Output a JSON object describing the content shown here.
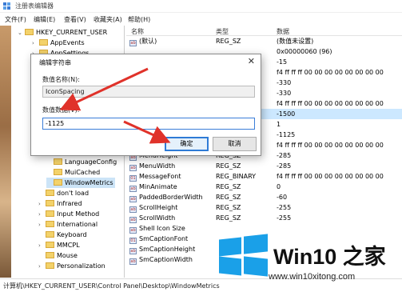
{
  "window": {
    "title": "注册表编辑器"
  },
  "menu": [
    "文件(F)",
    "编辑(E)",
    "查看(V)",
    "收藏夹(A)",
    "帮助(H)"
  ],
  "tree": {
    "items": [
      {
        "label": "HKEY_CURRENT_USER",
        "expanded": true
      },
      {
        "label": "AppEvents"
      },
      {
        "label": "AppSettings"
      },
      {
        "label": "LanguageConfig"
      },
      {
        "label": "MuiCached"
      },
      {
        "label": "WindowMetrics",
        "selected": true
      },
      {
        "label": "don't load"
      },
      {
        "label": "Infrared"
      },
      {
        "label": "Input Method"
      },
      {
        "label": "International"
      },
      {
        "label": "Keyboard"
      },
      {
        "label": "MMCPL"
      },
      {
        "label": "Mouse"
      },
      {
        "label": "Personalization"
      }
    ]
  },
  "list": {
    "headers": {
      "name": "名称",
      "type": "类型",
      "data": "数据"
    },
    "rows": [
      {
        "name": "(默认)",
        "type": "REG_SZ",
        "data": "(数值未设置)",
        "icon": "ab"
      },
      {
        "name": "",
        "type": "",
        "data": "0x00000060 (96)",
        "icon": ""
      },
      {
        "name": "",
        "type": "",
        "data": "-15",
        "icon": ""
      },
      {
        "name": "",
        "type": "",
        "data": "f4 ff ff ff 00 00 00 00 00 00 00 00",
        "icon": ""
      },
      {
        "name": "",
        "type": "",
        "data": "-330",
        "icon": ""
      },
      {
        "name": "",
        "type": "",
        "data": "-330",
        "icon": ""
      },
      {
        "name": "",
        "type": "",
        "data": "f4 ff ff ff 00 00 00 00 00 00 00 00",
        "icon": ""
      },
      {
        "name": "",
        "type": "",
        "data": "-1500",
        "icon": "",
        "selected": true
      },
      {
        "name": "",
        "type": "",
        "data": "1",
        "icon": ""
      },
      {
        "name": "",
        "type": "",
        "data": "-1125",
        "icon": ""
      },
      {
        "name": "",
        "type": "",
        "data": "f4 ff ff ff 00 00 00 00 00 00 00 00",
        "icon": ""
      },
      {
        "name": "MenuHeight",
        "type": "REG_SZ",
        "data": "-285",
        "icon": "ab"
      },
      {
        "name": "MenuWidth",
        "type": "REG_SZ",
        "data": "-285",
        "icon": "ab"
      },
      {
        "name": "MessageFont",
        "type": "REG_BINARY",
        "data": "f4 ff ff ff 00 00 00 00 00 00 00 00",
        "icon": "bin"
      },
      {
        "name": "MinAnimate",
        "type": "REG_SZ",
        "data": "0",
        "icon": "ab"
      },
      {
        "name": "PaddedBorderWidth",
        "type": "REG_SZ",
        "data": "-60",
        "icon": "ab"
      },
      {
        "name": "ScrollHeight",
        "type": "REG_SZ",
        "data": "-255",
        "icon": "ab"
      },
      {
        "name": "ScrollWidth",
        "type": "REG_SZ",
        "data": "-255",
        "icon": "ab"
      },
      {
        "name": "Shell Icon Size",
        "type": "",
        "data": "",
        "icon": "ab"
      },
      {
        "name": "SmCaptionFont",
        "type": "",
        "data": "",
        "icon": "bin"
      },
      {
        "name": "SmCaptionHeight",
        "type": "",
        "data": "",
        "icon": "ab"
      },
      {
        "name": "SmCaptionWidth",
        "type": "",
        "data": "",
        "icon": "ab"
      }
    ]
  },
  "status": {
    "path": "计算机\\HKEY_CURRENT_USER\\Control Panel\\Desktop\\WindowMetrics"
  },
  "dialog": {
    "title": "编辑字符串",
    "close": "✕",
    "name_label": "数值名称(N):",
    "name_value": "IconSpacing",
    "data_label": "数值数据(V):",
    "data_value": "-1125",
    "ok": "确定",
    "cancel": "取消"
  },
  "watermark": {
    "brand": "Win10 之家",
    "site": "www.win10xitong.com"
  },
  "colors": {
    "arrow": "#e0322a",
    "selection": "#cce8ff",
    "win_blue": "#1aa0e8"
  }
}
